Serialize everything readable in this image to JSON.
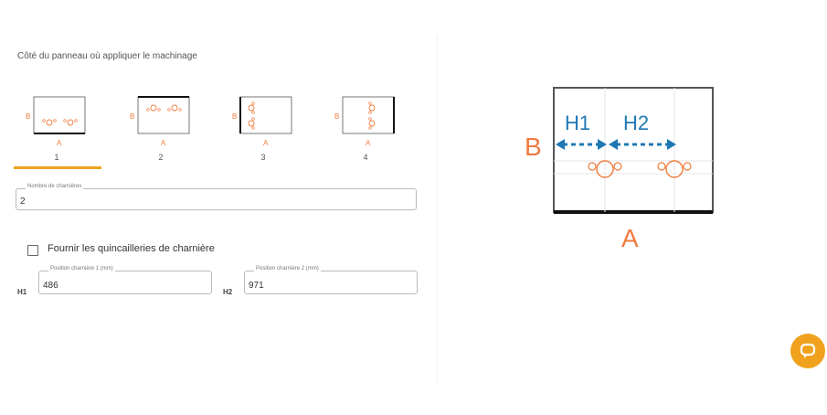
{
  "section": {
    "title": "Côté du panneau où appliquer le machinage"
  },
  "side_options": [
    {
      "number": "1",
      "label_a": "A",
      "label_b": "B"
    },
    {
      "number": "2",
      "label_a": "A",
      "label_b": "B"
    },
    {
      "number": "3",
      "label_a": "A",
      "label_b": "B"
    },
    {
      "number": "4",
      "label_a": "A",
      "label_b": "B"
    }
  ],
  "selected_side": 1,
  "hinge_count": {
    "legend": "Nombre de charnières",
    "value": "2"
  },
  "hardware": {
    "label": "Fournir les quincailleries de charnière",
    "checked": false
  },
  "positions": [
    {
      "tag": "H1",
      "legend": "Position charnière 1 (mm)",
      "value": "486"
    },
    {
      "tag": "H2",
      "legend": "Position charnière 2 (mm)",
      "value": "971"
    }
  ],
  "diagram": {
    "side_a": "A",
    "side_b": "B",
    "h1": "H1",
    "h2": "H2"
  },
  "colors": {
    "accent": "#f0a21e",
    "hinge_orange": "#f07b3f",
    "arrow_blue": "#1f78b4"
  }
}
